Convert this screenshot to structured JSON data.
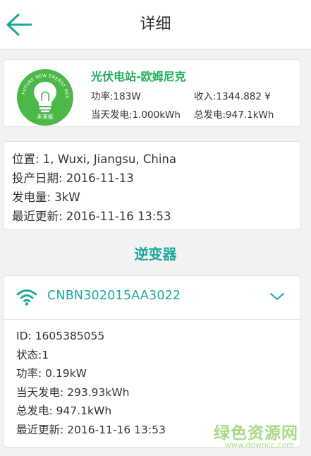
{
  "header": {
    "title": "详细",
    "back_icon": "arrow-left-icon"
  },
  "station": {
    "name": "光伏电站-欧姆尼克",
    "logo_text": "未来能",
    "logo_arc_text": "FUTURE NEW ENERGY RESOURCE",
    "power": "功率:183W",
    "income": "收入:1344.882 ¥",
    "today_energy": "当天发电:1.000kWh",
    "total_energy": "总发电:947.1kWh"
  },
  "info": {
    "location": "位置: 1, Wuxi, Jiangsu, China",
    "commission_date": "投产日期: 2016-11-13",
    "capacity": "发电量: 3kW",
    "last_update": "最近更新: 2016-11-16 13:53"
  },
  "section_title": "逆变器",
  "inverter": {
    "sn": "CNBN302015AA3022",
    "id": "ID:  1605385055",
    "status": "状态:1",
    "power": "功率:  0.19kW",
    "today_energy": "当天发电:  293.93kWh",
    "total_energy": "总发电:  947.1kWh",
    "last_update": "最近更新:  2016-11-16 13:53"
  },
  "watermark": {
    "name": "绿色资源网",
    "url": "www.downcc.com"
  },
  "colors": {
    "accent": "#1aa89a",
    "station_name": "#1fae5a",
    "logo_green": "#4cb848"
  }
}
